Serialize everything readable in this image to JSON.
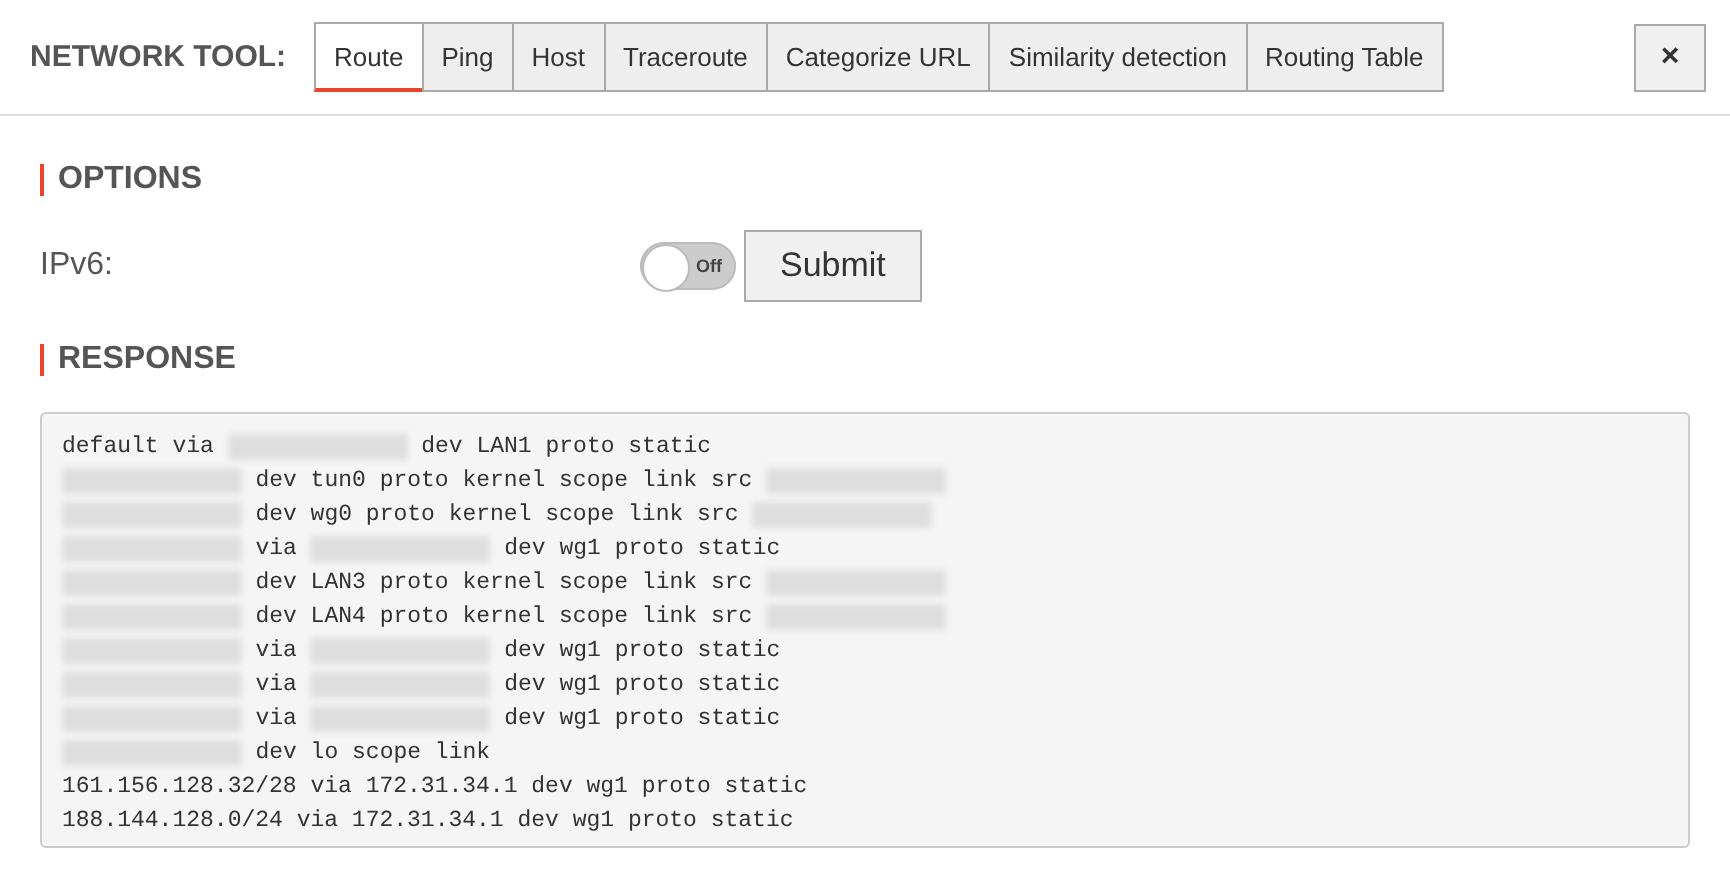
{
  "header": {
    "title": "NETWORK TOOL:",
    "close_button": "×"
  },
  "tabs": [
    {
      "label": "Route",
      "selected": true
    },
    {
      "label": "Ping",
      "selected": false
    },
    {
      "label": "Host",
      "selected": false
    },
    {
      "label": "Traceroute",
      "selected": false
    },
    {
      "label": "Categorize URL",
      "selected": false
    },
    {
      "label": "Similarity detection",
      "selected": false
    },
    {
      "label": "Routing Table",
      "selected": false
    }
  ],
  "options": {
    "heading": "OPTIONS",
    "ipv6": {
      "label": "IPv6:",
      "on": false,
      "toggle_text": "Off"
    },
    "submit_button": "Submit"
  },
  "response": {
    "heading": "RESPONSE",
    "lines": [
      [
        {
          "kind": "text",
          "text": "default via"
        },
        {
          "kind": "redacted"
        },
        {
          "kind": "text",
          "text": "dev LAN1 proto static"
        }
      ],
      [
        {
          "kind": "redacted"
        },
        {
          "kind": "text",
          "text": "dev tun0 proto kernel scope link src"
        },
        {
          "kind": "redacted"
        }
      ],
      [
        {
          "kind": "redacted"
        },
        {
          "kind": "text",
          "text": "dev wg0 proto kernel scope link src"
        },
        {
          "kind": "redacted"
        }
      ],
      [
        {
          "kind": "redacted"
        },
        {
          "kind": "text",
          "text": "via"
        },
        {
          "kind": "redacted"
        },
        {
          "kind": "text",
          "text": "dev wg1 proto static"
        }
      ],
      [
        {
          "kind": "redacted"
        },
        {
          "kind": "text",
          "text": "dev LAN3 proto kernel scope link src"
        },
        {
          "kind": "redacted"
        }
      ],
      [
        {
          "kind": "redacted"
        },
        {
          "kind": "text",
          "text": "dev LAN4 proto kernel scope link src"
        },
        {
          "kind": "redacted"
        }
      ],
      [
        {
          "kind": "redacted"
        },
        {
          "kind": "text",
          "text": "via"
        },
        {
          "kind": "redacted"
        },
        {
          "kind": "text",
          "text": "dev wg1 proto static"
        }
      ],
      [
        {
          "kind": "redacted"
        },
        {
          "kind": "text",
          "text": "via"
        },
        {
          "kind": "redacted"
        },
        {
          "kind": "text",
          "text": "dev wg1 proto static"
        }
      ],
      [
        {
          "kind": "redacted"
        },
        {
          "kind": "text",
          "text": "via"
        },
        {
          "kind": "redacted"
        },
        {
          "kind": "text",
          "text": "dev wg1 proto static"
        }
      ],
      [
        {
          "kind": "redacted"
        },
        {
          "kind": "text",
          "text": "dev lo scope link"
        }
      ],
      [
        {
          "kind": "text",
          "text": "161.156.128.32/28 via 172.31.34.1 dev wg1 proto static"
        }
      ],
      [
        {
          "kind": "text",
          "text": "188.144.128.0/24 via 172.31.34.1 dev wg1 proto static"
        }
      ]
    ]
  }
}
